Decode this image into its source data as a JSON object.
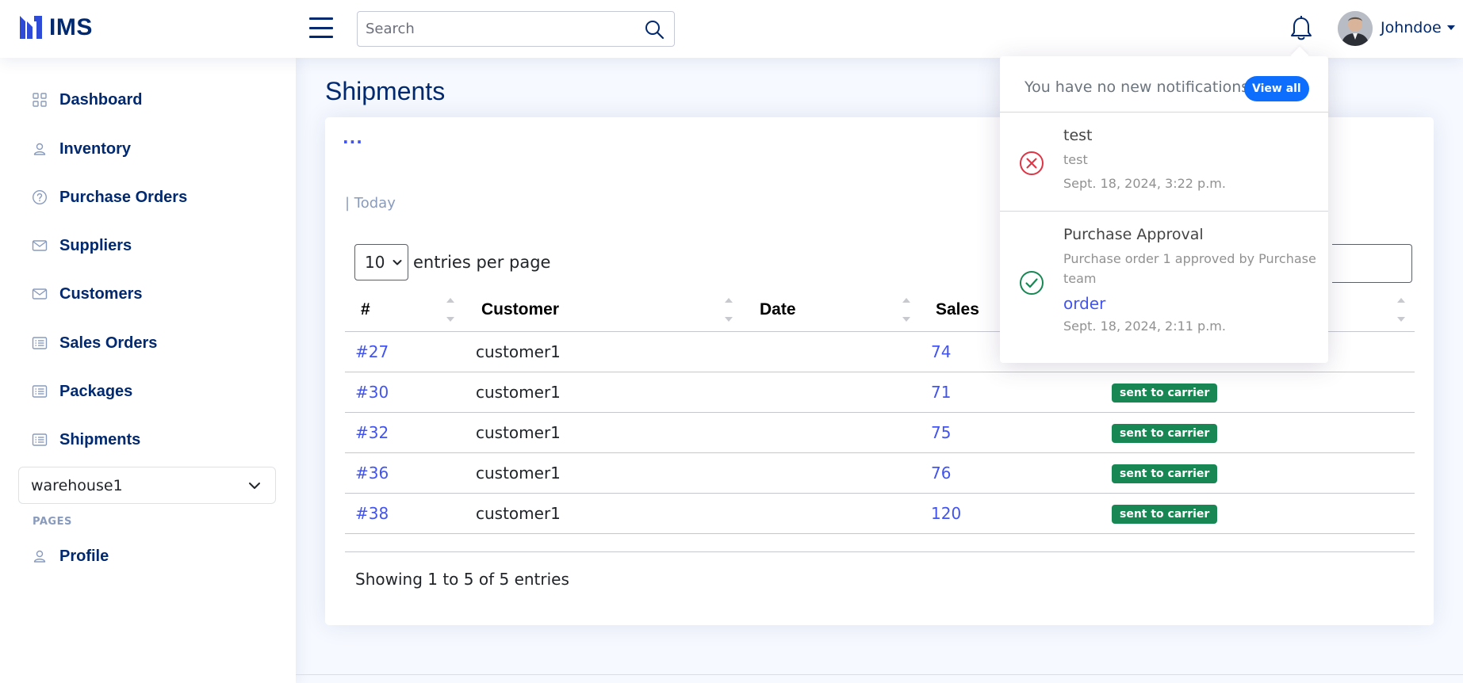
{
  "brand": {
    "name": "IMS"
  },
  "header": {
    "search_placeholder": "Search",
    "username": "Johndoe"
  },
  "sidebar": {
    "items": [
      {
        "label": "Dashboard",
        "icon": "grid-icon"
      },
      {
        "label": "Inventory",
        "icon": "person-icon"
      },
      {
        "label": "Purchase Orders",
        "icon": "question-circle-icon"
      },
      {
        "label": "Suppliers",
        "icon": "envelope-icon"
      },
      {
        "label": "Customers",
        "icon": "envelope-icon"
      },
      {
        "label": "Sales Orders",
        "icon": "list-icon"
      },
      {
        "label": "Packages",
        "icon": "list-icon"
      },
      {
        "label": "Shipments",
        "icon": "list-icon"
      }
    ],
    "warehouse": "warehouse1",
    "pages_heading": "PAGES",
    "profile_label": "Profile"
  },
  "main": {
    "title": "Shipments",
    "menu_dots": "...",
    "filter_label": "| Today",
    "entries_value": "10",
    "entries_label": "entries per page",
    "columns": [
      "#",
      "Customer",
      "Date",
      "Sales",
      ""
    ],
    "rows": [
      {
        "id": "#27",
        "customer": "customer1",
        "date": "",
        "sales": "74",
        "status": ""
      },
      {
        "id": "#30",
        "customer": "customer1",
        "date": "",
        "sales": "71",
        "status": "sent to carrier"
      },
      {
        "id": "#32",
        "customer": "customer1",
        "date": "",
        "sales": "75",
        "status": "sent to carrier"
      },
      {
        "id": "#36",
        "customer": "customer1",
        "date": "",
        "sales": "76",
        "status": "sent to carrier"
      },
      {
        "id": "#38",
        "customer": "customer1",
        "date": "",
        "sales": "120",
        "status": "sent to carrier"
      }
    ],
    "showing": "Showing 1 to 5 of 5 entries"
  },
  "notifications": {
    "header": "You have no new notifications",
    "view_all": "View all",
    "items": [
      {
        "title": "test",
        "message": "test",
        "link": "",
        "time": "Sept. 18, 2024, 3:22 p.m.",
        "status": "error"
      },
      {
        "title": "Purchase Approval",
        "message": "Purchase order 1 approved by Purchase team",
        "link": "order",
        "time": "Sept. 18, 2024, 2:11 p.m.",
        "status": "success"
      }
    ]
  },
  "colors": {
    "primary": "#012970",
    "accent": "#4154f1",
    "badge_success": "#198754",
    "view_all_bg": "#0d6efd",
    "error_icon": "#dc3545"
  }
}
